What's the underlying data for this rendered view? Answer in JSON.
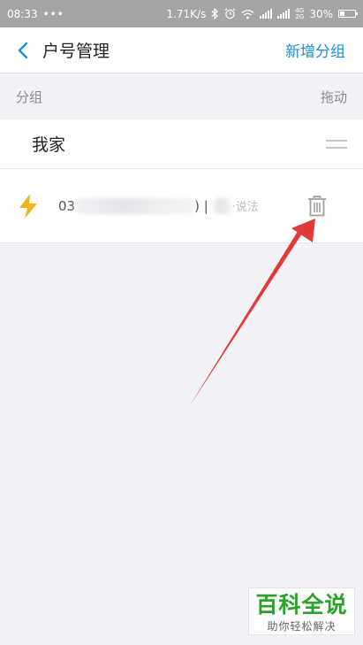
{
  "status_bar": {
    "time": "08:33",
    "dots": "•••",
    "speed": "1.71K/s",
    "network": "4G 2G",
    "battery": "30%",
    "battery_level": 0.3
  },
  "nav": {
    "title": "户号管理",
    "action_label": "新增分组"
  },
  "section": {
    "group_label": "分组",
    "drag_label": "拖动"
  },
  "group": {
    "name": "我家"
  },
  "account": {
    "id_prefix": "03",
    "id_suffix": ")",
    "separator": "|",
    "name_tail": "·说法"
  },
  "watermark": {
    "title": "百科全说",
    "subtitle": "助你轻松解决"
  },
  "colors": {
    "accent": "#1e8fd6",
    "bolt": "#f5b21b",
    "arrow": "#e03a3a",
    "watermark": "#2aa12a"
  }
}
